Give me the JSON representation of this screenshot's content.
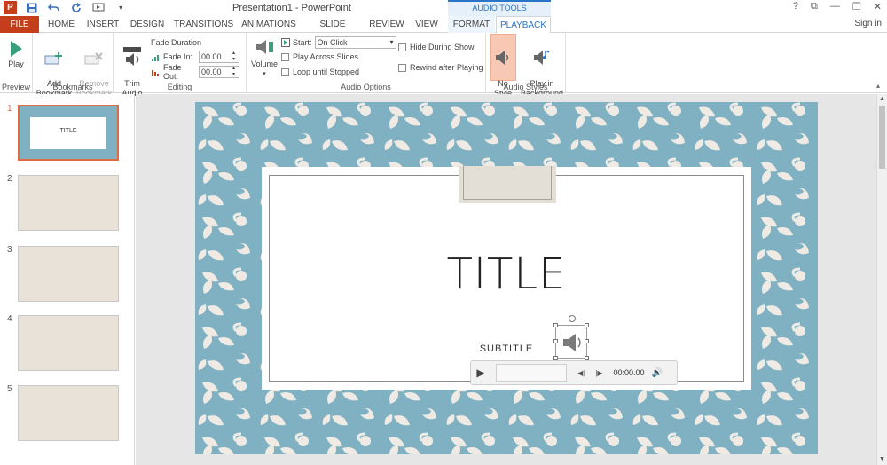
{
  "window": {
    "title": "Presentation1 - PowerPoint",
    "context_tab_header": "AUDIO TOOLS",
    "controls": [
      "?",
      "⧉",
      "—",
      "❐",
      "✕"
    ],
    "sign_in": "Sign in"
  },
  "tabs": [
    {
      "label": "FILE"
    },
    {
      "label": "HOME"
    },
    {
      "label": "INSERT"
    },
    {
      "label": "DESIGN"
    },
    {
      "label": "TRANSITIONS"
    },
    {
      "label": "ANIMATIONS"
    },
    {
      "label": "SLIDE SHOW"
    },
    {
      "label": "REVIEW"
    },
    {
      "label": "VIEW"
    },
    {
      "label": "FORMAT"
    },
    {
      "label": "PLAYBACK"
    }
  ],
  "ribbon": {
    "preview": {
      "label": "Preview",
      "play": "Play"
    },
    "bookmarks": {
      "label": "Bookmarks",
      "add": "Add\nBookmark",
      "remove": "Remove\nBookmark"
    },
    "editing": {
      "label": "Editing",
      "trim": "Trim\nAudio",
      "fade_duration": "Fade Duration",
      "fade_in_label": "Fade In:",
      "fade_in_value": "00.00",
      "fade_out_label": "Fade Out:",
      "fade_out_value": "00.00"
    },
    "audio_options": {
      "label": "Audio Options",
      "volume": "Volume",
      "start_label": "Start:",
      "start_value": "On Click",
      "play_across": "Play Across Slides",
      "loop": "Loop until Stopped",
      "hide": "Hide During Show",
      "rewind": "Rewind after Playing"
    },
    "audio_styles": {
      "label": "Audio Styles",
      "no_style": "No\nStyle",
      "play_bg": "Play in\nBackground"
    }
  },
  "slides": {
    "numbers": [
      "1",
      "2",
      "3",
      "4",
      "5"
    ],
    "thumb_title": "TITLE"
  },
  "slide": {
    "title": "TITLE",
    "subtitle": "SUBTITLE",
    "player_time": "00:00.00"
  },
  "colors": {
    "accent": "#c43e1c",
    "blue": "#2b75c9",
    "slide_bg": "#7fb1c2",
    "pattern": "#efebe4"
  }
}
